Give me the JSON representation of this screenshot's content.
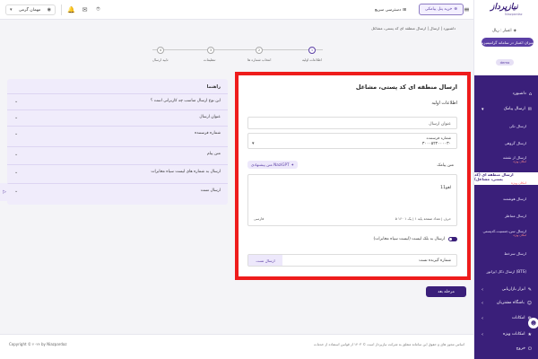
{
  "topbar": {
    "user_name": "مهمان گرمی",
    "quick_access_label": "دسترسی سریع",
    "buy_sms_label": "خرید پنل پیامکی"
  },
  "sidebar": {
    "logo": "نیازپرداز",
    "logo_sub": "Niazpardaz",
    "credit_label": "اعتبار : ریال",
    "credit_button": "میزان اعتبار در سامانه گرانتیمیزه",
    "demo_label": "demo",
    "items": [
      {
        "label": "داشبورد"
      },
      {
        "label": "ارسال پیامک"
      },
      {
        "label": "ابزار بازاریابی"
      },
      {
        "label": "باشگاه مشتریان"
      },
      {
        "label": "امکانات"
      },
      {
        "label": "امکانات ویژه"
      },
      {
        "label": "خروج"
      }
    ],
    "subitems": [
      {
        "label": "ارسال تکی",
        "tag": ""
      },
      {
        "label": "ارسال گروهی",
        "tag": ""
      },
      {
        "label": "ارسال از نقشه",
        "tag": "امکان ویژه"
      },
      {
        "label": "ارسال منطقه ای (کد پستی، مشاغل)",
        "tag": "امکان ویژه"
      },
      {
        "label": "ارسال هوشمند",
        "tag": ""
      },
      {
        "label": "ارسال متناظر",
        "tag": ""
      },
      {
        "label": "ارسال سن،جنسیت،کدپستی",
        "tag": "امکان ویژه"
      },
      {
        "label": "ارسال سرخط",
        "tag": ""
      },
      {
        "label": "ارسال BTS",
        "tag": "امکان ویژه"
      },
      {
        "label": "ارسال ذکل اپراتور (BTS)",
        "tag": ""
      }
    ]
  },
  "breadcrumb": "داشبورد  |  ارسال  |  ارسال منطقه ای کد پستی، مشاغل",
  "steps": [
    {
      "num": "1",
      "label": "اطلاعات اولیه"
    },
    {
      "num": "2",
      "label": "انتخاب شماره ها"
    },
    {
      "num": "3",
      "label": "تنظیمات"
    },
    {
      "num": "4",
      "label": "تایید ارسال"
    }
  ],
  "form": {
    "title": "ارسال منطقه ای کد پستی، مشاغل",
    "section_title": "اطلاعات اولیه",
    "send_title_placeholder": "عنوان ارسال",
    "sender_label": "شماره فرستنده",
    "sender_value": "۳۰۰۰۵۲۲۰۰۰۰۳۰",
    "message_label": "متن پیامک",
    "nazi_button": "متن پیشنهادی NaziGPT",
    "message_text": "لغو11",
    "message_counter": "۵ حرف   |   تعداد صفحه پایه ۱   |   یک ۱ ۱۶۰",
    "message_lang": "فارسی",
    "blacklist_toggle": "ارسال به بلک لیست (لیست سیاه مخابرات)",
    "recipient_label": "شماره گیرنده تست",
    "send_test_button": "ارسال تست"
  },
  "guide": {
    "title": "راهنما",
    "items": [
      "این نوع ارسال مناسب چه کاربرانی است ؟",
      "عنوان ارسال",
      "شماره فرستنده",
      "متن پیام",
      "ارسال به شماره های لیست سیاه مخابرات",
      "ارسال تست"
    ]
  },
  "next_button": "مرحله بعد",
  "footer": {
    "copyright": "Copyright © ۲۰۲۴ by Niazpardaz",
    "notice": "اساس مجوز های و حقوق این سامانه متعلق به شرکت نیازپرداز است © ۱۴۰۳ از قوانین استفاده از خدمات"
  },
  "colors": {
    "brand": "#3a1f7a",
    "accent": "#5b3fa5",
    "highlight_frame": "#ee1c1c"
  }
}
